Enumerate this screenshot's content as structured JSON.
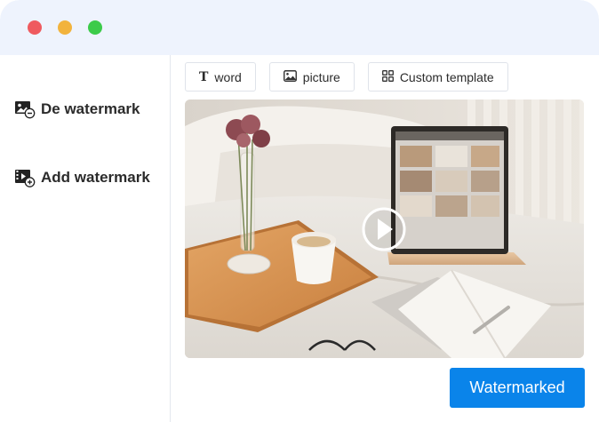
{
  "sidebar": {
    "items": [
      {
        "label": "De watermark",
        "icon": "image-minus-icon"
      },
      {
        "label": "Add watermark",
        "icon": "video-plus-icon"
      }
    ]
  },
  "toolbar": {
    "tabs": [
      {
        "label": "word",
        "icon": "text-t-icon"
      },
      {
        "label": "picture",
        "icon": "image-icon"
      },
      {
        "label": "Custom template",
        "icon": "grid-template-icon"
      }
    ]
  },
  "preview": {
    "media": "video-thumbnail",
    "play_icon": "play-circle-icon"
  },
  "actions": {
    "submit_label": "Watermarked"
  },
  "colors": {
    "titlebar_bg": "#eef3fd",
    "accent": "#0a84ea",
    "close": "#ef5a5f",
    "minimize": "#f2b33d",
    "maximize": "#3ccb4a"
  }
}
